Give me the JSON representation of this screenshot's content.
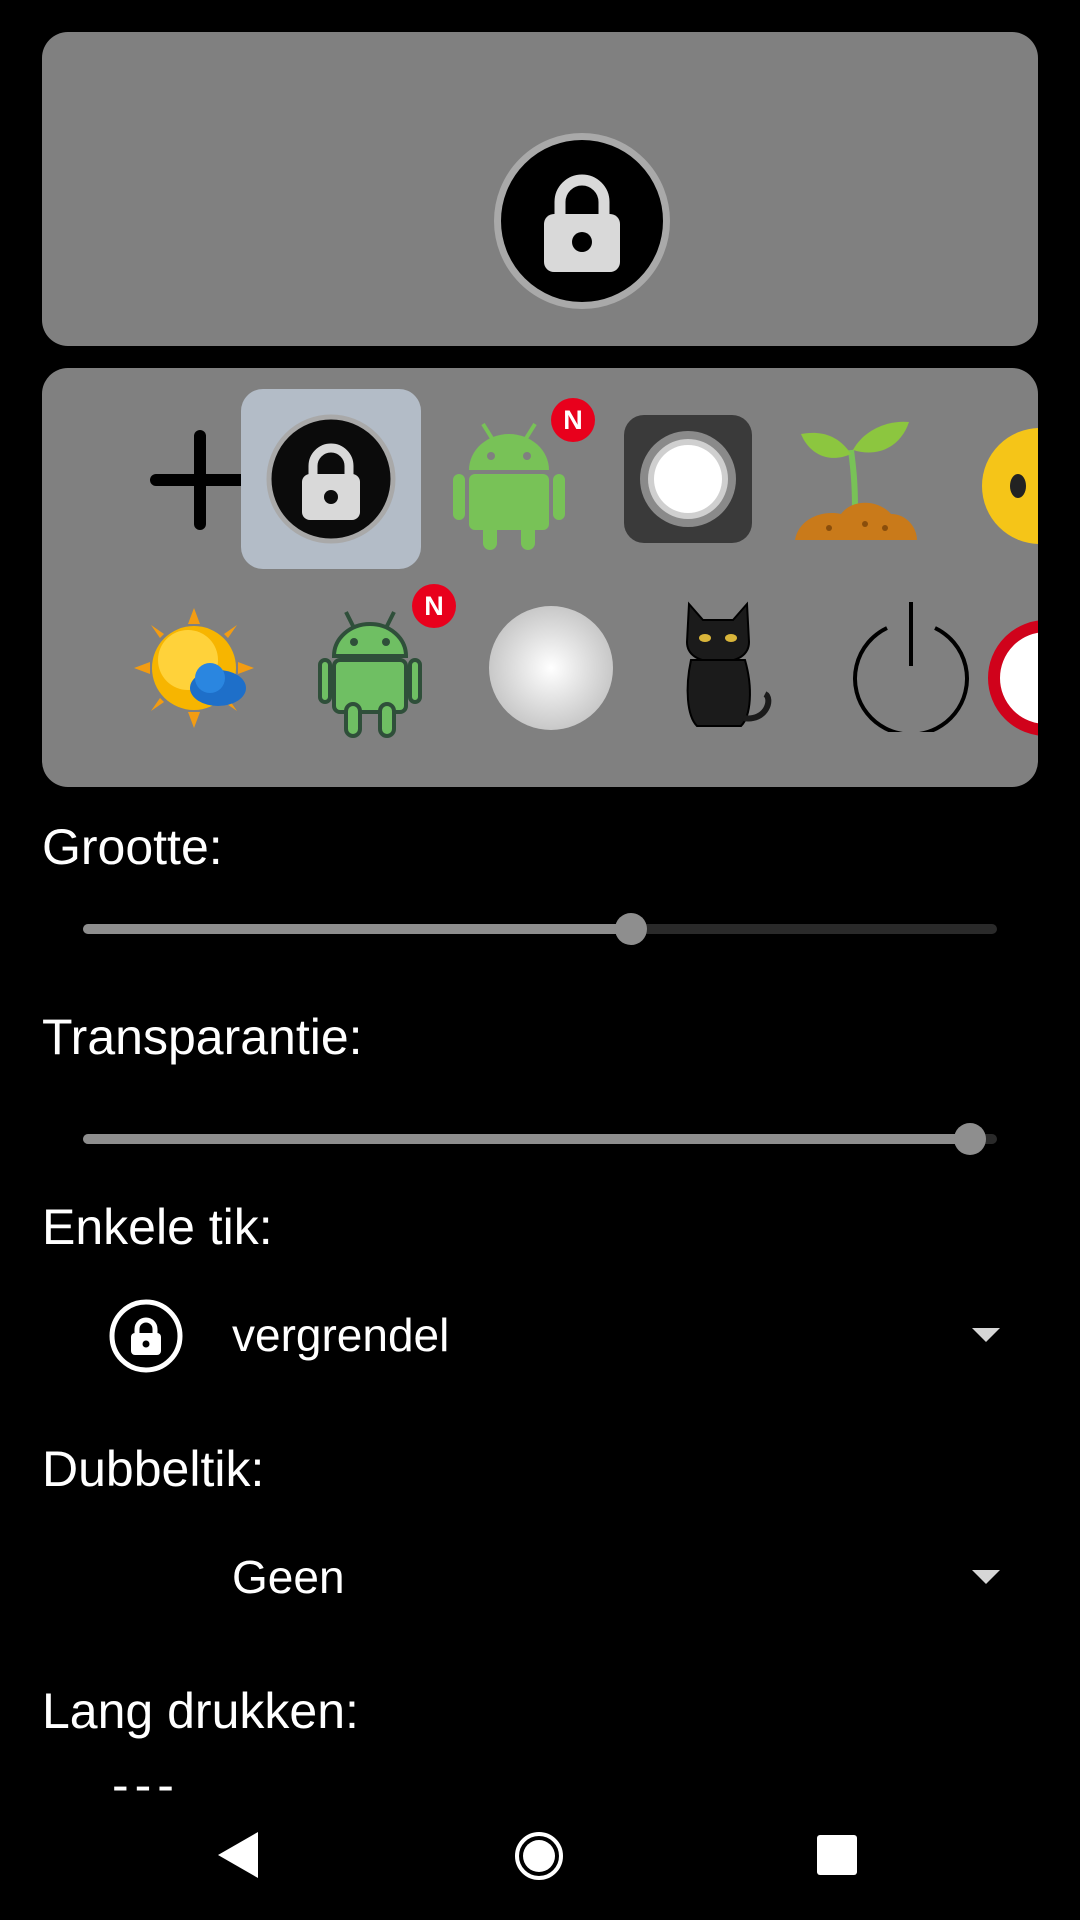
{
  "preview": {
    "icon": "lock-icon"
  },
  "gallery": {
    "row1": [
      {
        "icon": "plus-icon"
      },
      {
        "icon": "lock-icon",
        "selected": true
      },
      {
        "icon": "android-icon",
        "badge": "N"
      },
      {
        "icon": "assistive-touch-icon"
      },
      {
        "icon": "sprout-icon"
      },
      {
        "icon": "emoji-face-icon"
      }
    ],
    "row2": [
      {
        "icon": "sun-cloud-icon"
      },
      {
        "icon": "android-outline-icon",
        "badge": "N"
      },
      {
        "icon": "white-circle-icon"
      },
      {
        "icon": "black-cat-icon"
      },
      {
        "icon": "power-icon"
      },
      {
        "icon": "no-sign-icon"
      }
    ]
  },
  "settings": {
    "size_label": "Grootte:",
    "size_value": 0.6,
    "transparency_label": "Transparantie:",
    "transparency_value": 0.97,
    "single_tap_label": "Enkele tik:",
    "single_tap_value": "vergrendel",
    "double_tap_label": "Dubbeltik:",
    "double_tap_value": "Geen",
    "long_press_label": "Lang drukken:",
    "long_press_value": "---"
  },
  "navbar": {
    "back": "back-icon",
    "home": "home-icon",
    "recents": "recents-icon"
  },
  "colors": {
    "panel": "#808080",
    "selected": "#b3bcc7",
    "badge": "#e8001c",
    "android_green": "#78c257"
  }
}
